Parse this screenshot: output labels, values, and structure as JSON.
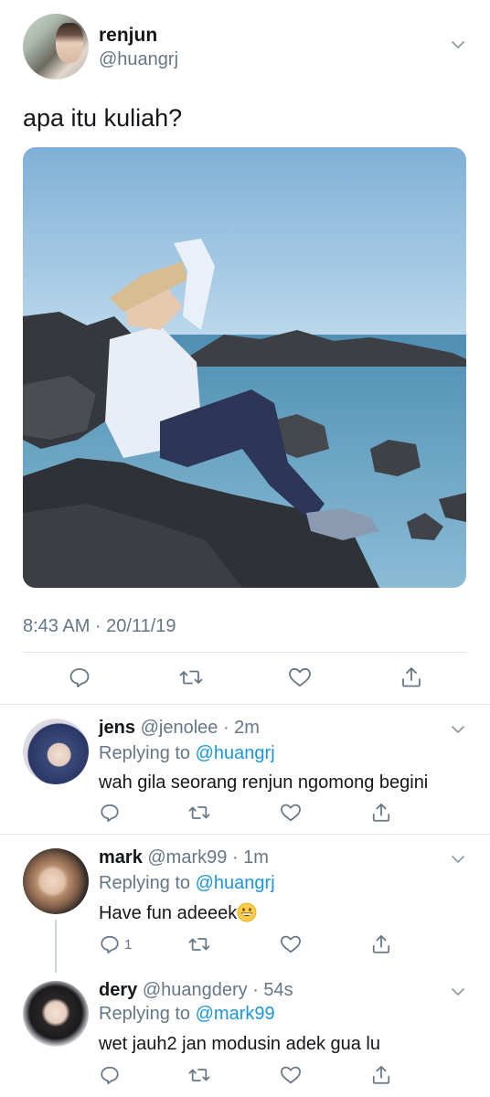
{
  "tweet": {
    "name": "renjun",
    "handle": "@huangrj",
    "text": "apa itu kuliah?",
    "timestamp": "8:43 AM · 20/11/19"
  },
  "replies": [
    {
      "name": "jens",
      "handle": "@jenolee",
      "time": "· 2m",
      "replying_prefix": "Replying to ",
      "replying_to": "@huangrj",
      "text": "wah gila seorang renjun ngomong begini",
      "reply_count": ""
    },
    {
      "name": "mark",
      "handle": "@mark99",
      "time": "· 1m",
      "replying_prefix": "Replying to ",
      "replying_to": "@huangrj",
      "text": "Have fun adeeek",
      "reply_count": "1"
    },
    {
      "name": "dery",
      "handle": "@huangdery",
      "time": "· 54s",
      "replying_prefix": "Replying to ",
      "replying_to": "@mark99",
      "text": "wet jauh2 jan modusin adek gua lu",
      "reply_count": ""
    }
  ],
  "icons": {
    "reply": "reply-icon",
    "retweet": "retweet-icon",
    "like": "like-icon",
    "share": "share-icon",
    "more": "chevron-down-icon",
    "emoji": "grinning-face-emoji"
  },
  "colors": {
    "text": "#14171a",
    "secondary": "#657786",
    "link": "#1b95e0",
    "divider": "#e1e8ed"
  }
}
